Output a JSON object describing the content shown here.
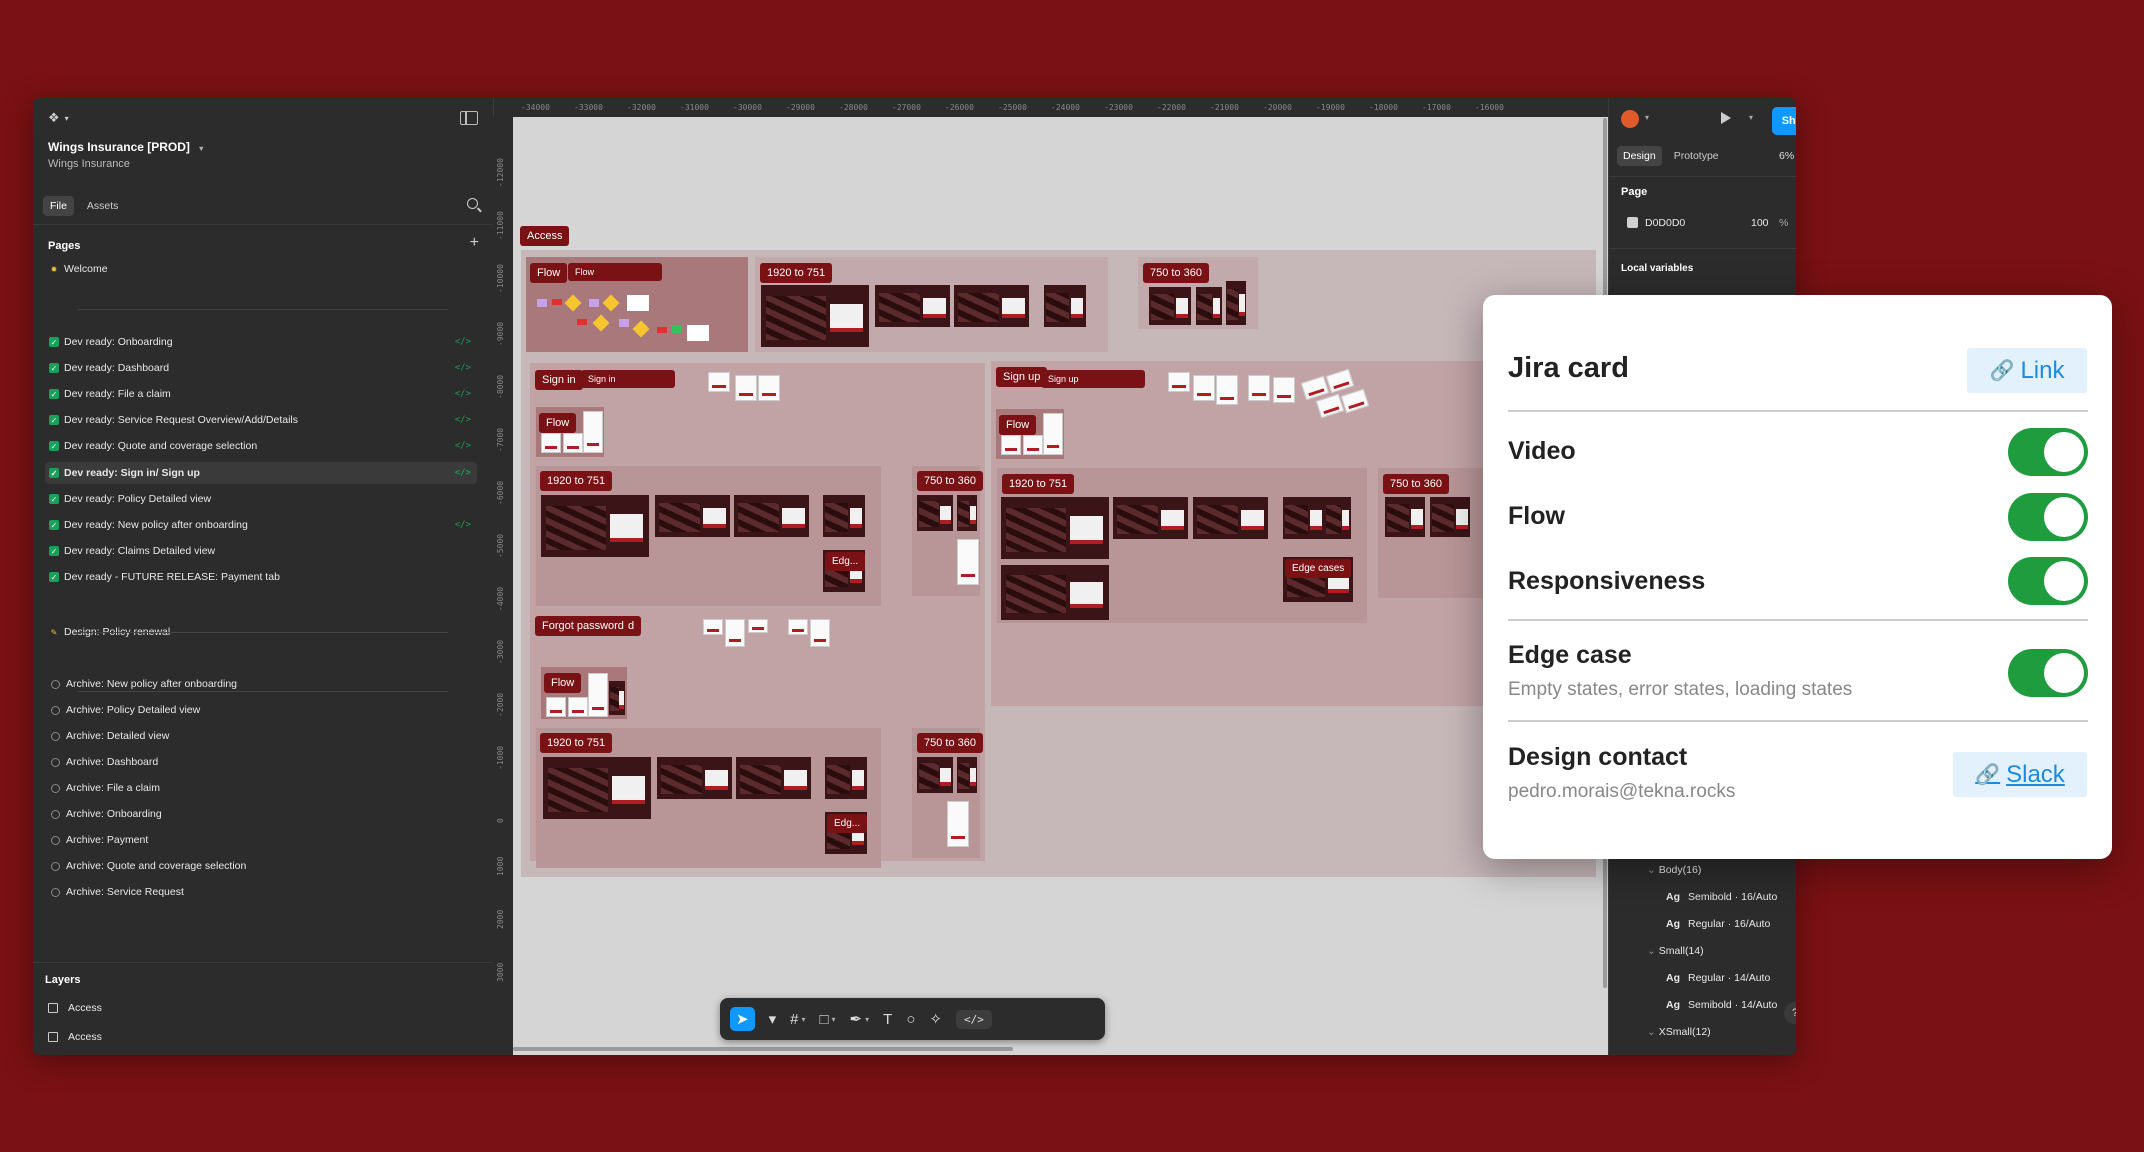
{
  "app": {
    "project_title": "Wings Insurance [PROD]",
    "project_subtitle": "Wings Insurance"
  },
  "left_panel": {
    "tabs": [
      {
        "label": "File"
      },
      {
        "label": "Assets"
      }
    ],
    "pages_heading": "Pages",
    "pages": [
      {
        "label": "Welcome",
        "kind": "sun"
      },
      {
        "label": "Dev ready:  Onboarding",
        "kind": "check",
        "code": true
      },
      {
        "label": "Dev ready: Dashboard",
        "kind": "check",
        "code": true
      },
      {
        "label": "Dev ready: File a claim",
        "kind": "check",
        "code": true
      },
      {
        "label": "Dev ready:  Service Request Overview/Add/Details",
        "kind": "check",
        "code": true
      },
      {
        "label": "Dev ready: Quote and coverage selection",
        "kind": "check",
        "code": true
      },
      {
        "label": "Dev ready:  Sign in/ Sign up",
        "kind": "check",
        "code": true,
        "selected": true
      },
      {
        "label": "Dev ready:  Policy Detailed view",
        "kind": "check",
        "code": false
      },
      {
        "label": "Dev ready:  New policy after onboarding",
        "kind": "check",
        "code": true
      },
      {
        "label": "Dev ready:  Claims Detailed view",
        "kind": "check",
        "code": false
      },
      {
        "label": "Dev ready - FUTURE RELEASE:  Payment tab",
        "kind": "check",
        "code": false
      },
      {
        "label": "Design: Policy renewal",
        "kind": "pencil"
      },
      {
        "label": "Archive: New policy after onboarding",
        "kind": "archive"
      },
      {
        "label": "Archive: Policy Detailed view",
        "kind": "archive"
      },
      {
        "label": "Archive: Detailed view",
        "kind": "archive"
      },
      {
        "label": "Archive: Dashboard",
        "kind": "archive"
      },
      {
        "label": "Archive: File a claim",
        "kind": "archive"
      },
      {
        "label": "Archive: Onboarding",
        "kind": "archive"
      },
      {
        "label": "Archive: Payment",
        "kind": "archive"
      },
      {
        "label": "Archive: Quote and coverage selection",
        "kind": "archive"
      },
      {
        "label": "Archive: Service Request",
        "kind": "archive"
      }
    ],
    "layers_heading": "Layers",
    "layers": [
      {
        "label": "Access"
      },
      {
        "label": "Access"
      }
    ]
  },
  "ruler_top": [
    "-34000",
    "-33000",
    "-32000",
    "-31000",
    "-30000",
    "-29000",
    "-28000",
    "-27000",
    "-26000",
    "-25000",
    "-24000",
    "-23000",
    "-22000",
    "-21000",
    "-20000",
    "-19000",
    "-18000",
    "-17000",
    "-16000"
  ],
  "ruler_left": [
    "-12000",
    "-11000",
    "-10000",
    "-9000",
    "-8000",
    "-7000",
    "-6000",
    "-5000",
    "-4000",
    "-3000",
    "-2000",
    "-1000",
    "0",
    "1000",
    "2000",
    "3000"
  ],
  "canvas": {
    "access": "Access",
    "flow": "Flow",
    "r1920": "1920 to 751",
    "r750": "750 to 360",
    "sign_in": "Sign in",
    "sign_up": "Sign up",
    "forgot": "Forgot password",
    "forgot_trail": "d",
    "edge_cases": "Edge cases",
    "edg_a": "Edg...",
    "edg_b": "Edg..."
  },
  "right_panel": {
    "tabs": [
      {
        "label": "Design"
      },
      {
        "label": "Prototype"
      }
    ],
    "share": "Share",
    "zoom": "6%",
    "page_heading": "Page",
    "page_color": "D0D0D0",
    "page_opacity": "100",
    "page_pct": "%",
    "local_variables": "Local variables",
    "styles": [
      {
        "text": "Body(16)",
        "indent": 0
      },
      {
        "prefix": "Ag",
        "text": "Semibold · 16/Auto",
        "indent": 1
      },
      {
        "prefix": "Ag",
        "text": "Regular · 16/Auto",
        "indent": 1
      },
      {
        "text": "Small(14)",
        "indent": 0
      },
      {
        "prefix": "Ag",
        "text": "Regular · 14/Auto",
        "indent": 1
      },
      {
        "prefix": "Ag",
        "text": "Semibold · 14/Auto",
        "indent": 1
      },
      {
        "text": "XSmall(12)",
        "indent": 0
      }
    ],
    "help": "?"
  },
  "jira_card": {
    "title": "Jira card",
    "link_label": "Link",
    "rows": [
      {
        "label": "Video",
        "enabled": true
      },
      {
        "label": "Flow",
        "enabled": true
      },
      {
        "label": "Responsiveness",
        "enabled": true
      },
      {
        "label": "Edge case",
        "sub": "Empty states, error states, loading states",
        "enabled": true
      }
    ],
    "contact_label": "Design contact",
    "contact_email": "pedro.morais@tekna.rocks",
    "slack_label": "Slack"
  },
  "colors": {
    "background": "#7a1114",
    "accent": "#0d99ff",
    "toggle_on": "#1f9c3e",
    "link": "#1a8be0"
  }
}
